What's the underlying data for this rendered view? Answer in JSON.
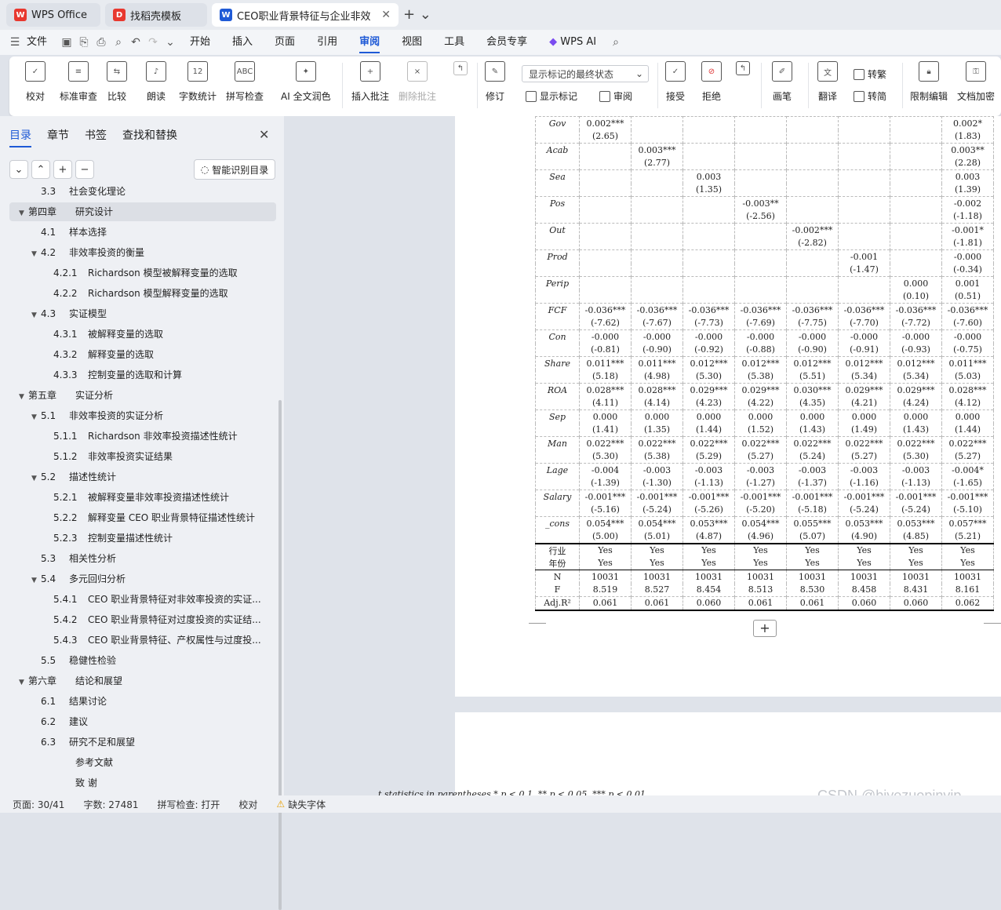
{
  "tabs": [
    {
      "label": "WPS Office"
    },
    {
      "label": "找稻壳模板"
    },
    {
      "label": "CEO职业背景特征与企业非效率"
    }
  ],
  "menu": {
    "file": "文件",
    "items": [
      "开始",
      "插入",
      "页面",
      "引用",
      "审阅",
      "视图",
      "工具",
      "会员专享"
    ],
    "ai": "WPS AI"
  },
  "ribbon": {
    "proof": "校对",
    "std": "标准审查",
    "compare": "比较",
    "read": "朗读",
    "count": "字数统计",
    "spell": "拼写检查",
    "ai_polish": "AI 全文润色",
    "insert_comment": "插入批注",
    "delete_comment": "删除批注",
    "track": "修订",
    "show_markup": "显示标记",
    "review": "审阅",
    "display_select": "显示标记的最终状态",
    "accept": "接受",
    "reject": "拒绝",
    "pen": "画笔",
    "translate": "翻译",
    "to_trad": "转繁",
    "to_simp": "转简",
    "restrict": "限制编辑",
    "encrypt": "文档加密"
  },
  "sidebar": {
    "tabs": [
      "目录",
      "章节",
      "书签",
      "查找和替换"
    ],
    "ai_toc": "智能识别目录",
    "toc": [
      {
        "num": "3.3",
        "text": "社会变化理论",
        "level": 1
      },
      {
        "num": "第四章",
        "text": "研究设计",
        "level": 0
      },
      {
        "num": "4.1",
        "text": "样本选择",
        "level": 1
      },
      {
        "num": "4.2",
        "text": "非效率投资的衡量",
        "level": 1
      },
      {
        "num": "4.2.1",
        "text": "Richardson 模型被解释变量的选取",
        "level": 2
      },
      {
        "num": "4.2.2",
        "text": "Richardson 模型解释变量的选取",
        "level": 2
      },
      {
        "num": "4.3",
        "text": "实证模型",
        "level": 1
      },
      {
        "num": "4.3.1",
        "text": "被解释变量的选取",
        "level": 2
      },
      {
        "num": "4.3.2",
        "text": "解释变量的选取",
        "level": 2
      },
      {
        "num": "4.3.3",
        "text": "控制变量的选取和计算",
        "level": 2
      },
      {
        "num": "第五章",
        "text": "实证分析",
        "level": 0
      },
      {
        "num": "5.1",
        "text": "非效率投资的实证分析",
        "level": 1
      },
      {
        "num": "5.1.1",
        "text": "Richardson 非效率投资描述性统计",
        "level": 2
      },
      {
        "num": "5.1.2",
        "text": "非效率投资实证结果",
        "level": 2
      },
      {
        "num": "5.2",
        "text": "描述性统计",
        "level": 1
      },
      {
        "num": "5.2.1",
        "text": "被解释变量非效率投资描述性统计",
        "level": 2
      },
      {
        "num": "5.2.2",
        "text": "解释变量 CEO 职业背景特征描述性统计",
        "level": 2
      },
      {
        "num": "5.2.3",
        "text": "控制变量描述性统计",
        "level": 2
      },
      {
        "num": "5.3",
        "text": "相关性分析",
        "level": 1
      },
      {
        "num": "5.4",
        "text": "多元回归分析",
        "level": 1
      },
      {
        "num": "5.4.1",
        "text": "CEO 职业背景特征对非效率投资的实证...",
        "level": 2
      },
      {
        "num": "5.4.2",
        "text": "CEO 职业背景特征对过度投资的实证结...",
        "level": 2
      },
      {
        "num": "5.4.3",
        "text": "CEO 职业背景特征、产权属性与过度投...",
        "level": 2
      },
      {
        "num": "5.5",
        "text": "稳健性检验",
        "level": 1
      },
      {
        "num": "第六章",
        "text": "结论和展望",
        "level": 0
      },
      {
        "num": "6.1",
        "text": "结果讨论",
        "level": 1
      },
      {
        "num": "6.2",
        "text": "建议",
        "level": 1
      },
      {
        "num": "6.3",
        "text": "研究不足和展望",
        "level": 1
      },
      {
        "num": "",
        "text": "参考文献",
        "level": 0
      },
      {
        "num": "",
        "text": "致 谢",
        "level": 0
      }
    ]
  },
  "table": {
    "rows": [
      [
        "Gov",
        "0.002***",
        "",
        "",
        "",
        "",
        "",
        "",
        "0.002*"
      ],
      [
        "",
        "(2.65)",
        "",
        "",
        "",
        "",
        "",
        "",
        "(1.83)"
      ],
      [
        "Acab",
        "",
        "0.003***",
        "",
        "",
        "",
        "",
        "",
        "0.003**"
      ],
      [
        "",
        "",
        "(2.77)",
        "",
        "",
        "",
        "",
        "",
        "(2.28)"
      ],
      [
        "Sea",
        "",
        "",
        "0.003",
        "",
        "",
        "",
        "",
        "0.003"
      ],
      [
        "",
        "",
        "",
        "(1.35)",
        "",
        "",
        "",
        "",
        "(1.39)"
      ],
      [
        "Pos",
        "",
        "",
        "",
        "-0.003**",
        "",
        "",
        "",
        "-0.002"
      ],
      [
        "",
        "",
        "",
        "",
        "(-2.56)",
        "",
        "",
        "",
        "(-1.18)"
      ],
      [
        "Out",
        "",
        "",
        "",
        "",
        "-0.002***",
        "",
        "",
        "-0.001*"
      ],
      [
        "",
        "",
        "",
        "",
        "",
        "(-2.82)",
        "",
        "",
        "(-1.81)"
      ],
      [
        "Prod",
        "",
        "",
        "",
        "",
        "",
        "-0.001",
        "",
        "-0.000"
      ],
      [
        "",
        "",
        "",
        "",
        "",
        "",
        "(-1.47)",
        "",
        "(-0.34)"
      ],
      [
        "Perip",
        "",
        "",
        "",
        "",
        "",
        "",
        "0.000",
        "0.001"
      ],
      [
        "",
        "",
        "",
        "",
        "",
        "",
        "",
        "(0.10)",
        "(0.51)"
      ],
      [
        "FCF",
        "-0.036***",
        "-0.036***",
        "-0.036***",
        "-0.036***",
        "-0.036***",
        "-0.036***",
        "-0.036***",
        "-0.036***"
      ],
      [
        "",
        "(-7.62)",
        "(-7.67)",
        "(-7.73)",
        "(-7.69)",
        "(-7.75)",
        "(-7.70)",
        "(-7.72)",
        "(-7.60)"
      ],
      [
        "Con",
        "-0.000",
        "-0.000",
        "-0.000",
        "-0.000",
        "-0.000",
        "-0.000",
        "-0.000",
        "-0.000"
      ],
      [
        "",
        "(-0.81)",
        "(-0.90)",
        "(-0.92)",
        "(-0.88)",
        "(-0.90)",
        "(-0.91)",
        "(-0.93)",
        "(-0.75)"
      ],
      [
        "Share",
        "0.011***",
        "0.011***",
        "0.012***",
        "0.012***",
        "0.012***",
        "0.012***",
        "0.012***",
        "0.011***"
      ],
      [
        "",
        "(5.18)",
        "(4.98)",
        "(5.30)",
        "(5.38)",
        "(5.51)",
        "(5.34)",
        "(5.34)",
        "(5.03)"
      ],
      [
        "ROA",
        "0.028***",
        "0.028***",
        "0.029***",
        "0.029***",
        "0.030***",
        "0.029***",
        "0.029***",
        "0.028***"
      ],
      [
        "",
        "(4.11)",
        "(4.14)",
        "(4.23)",
        "(4.22)",
        "(4.35)",
        "(4.21)",
        "(4.24)",
        "(4.12)"
      ],
      [
        "Sep",
        "0.000",
        "0.000",
        "0.000",
        "0.000",
        "0.000",
        "0.000",
        "0.000",
        "0.000"
      ],
      [
        "",
        "(1.41)",
        "(1.35)",
        "(1.44)",
        "(1.52)",
        "(1.43)",
        "(1.49)",
        "(1.43)",
        "(1.44)"
      ],
      [
        "Man",
        "0.022***",
        "0.022***",
        "0.022***",
        "0.022***",
        "0.022***",
        "0.022***",
        "0.022***",
        "0.022***"
      ],
      [
        "",
        "(5.30)",
        "(5.38)",
        "(5.29)",
        "(5.27)",
        "(5.24)",
        "(5.27)",
        "(5.30)",
        "(5.27)"
      ],
      [
        "Lage",
        "-0.004",
        "-0.003",
        "-0.003",
        "-0.003",
        "-0.003",
        "-0.003",
        "-0.003",
        "-0.004*"
      ],
      [
        "",
        "(-1.39)",
        "(-1.30)",
        "(-1.13)",
        "(-1.27)",
        "(-1.37)",
        "(-1.16)",
        "(-1.13)",
        "(-1.65)"
      ],
      [
        "Salary",
        "-0.001***",
        "-0.001***",
        "-0.001***",
        "-0.001***",
        "-0.001***",
        "-0.001***",
        "-0.001***",
        "-0.001***"
      ],
      [
        "",
        "(-5.16)",
        "(-5.24)",
        "(-5.26)",
        "(-5.20)",
        "(-5.18)",
        "(-5.24)",
        "(-5.24)",
        "(-5.10)"
      ],
      [
        "_cons",
        "0.054***",
        "0.054***",
        "0.053***",
        "0.054***",
        "0.055***",
        "0.053***",
        "0.053***",
        "0.057***"
      ],
      [
        "",
        "(5.00)",
        "(5.01)",
        "(4.87)",
        "(4.96)",
        "(5.07)",
        "(4.90)",
        "(4.85)",
        "(5.21)"
      ],
      [
        "行业",
        "Yes",
        "Yes",
        "Yes",
        "Yes",
        "Yes",
        "Yes",
        "Yes",
        "Yes"
      ],
      [
        "年份",
        "Yes",
        "Yes",
        "Yes",
        "Yes",
        "Yes",
        "Yes",
        "Yes",
        "Yes"
      ],
      [
        "N",
        "10031",
        "10031",
        "10031",
        "10031",
        "10031",
        "10031",
        "10031",
        "10031"
      ],
      [
        "F",
        "8.519",
        "8.527",
        "8.454",
        "8.513",
        "8.530",
        "8.458",
        "8.431",
        "8.161"
      ],
      [
        "Adj.R²",
        "0.061",
        "0.061",
        "0.060",
        "0.061",
        "0.061",
        "0.060",
        "0.060",
        "0.062"
      ]
    ]
  },
  "footnote": "t statistics in parentheses * p < 0.1, ** p < 0.05, *** p < 0.01",
  "status": {
    "page": "页面: 30/41",
    "words": "字数: 27481",
    "spell": "拼写检查: 打开",
    "proof": "校对",
    "font": "缺失字体"
  },
  "watermark": "CSDN @biyezuopinvip"
}
